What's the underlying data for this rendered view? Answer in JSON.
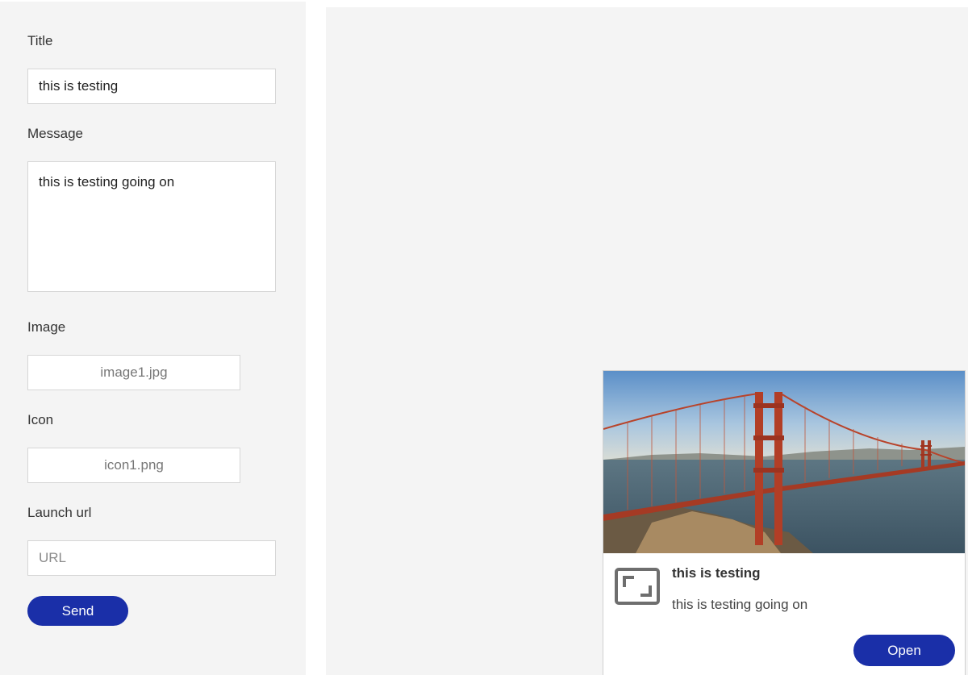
{
  "form": {
    "title_label": "Title",
    "title_value": "this is testing",
    "message_label": "Message",
    "message_value": "this is testing going on",
    "image_label": "Image",
    "image_file": "image1.jpg",
    "icon_label": "Icon",
    "icon_file": "icon1.png",
    "launch_url_label": "Launch url",
    "launch_url_placeholder": "URL",
    "send_label": "Send"
  },
  "preview": {
    "image_alt": "golden-gate-bridge-photo",
    "icon": "expand-frame-icon",
    "title": "this is testing",
    "message": "this is testing going on",
    "open_label": "Open"
  },
  "colors": {
    "accent": "#1a2fa8",
    "panel_bg": "#f4f4f4",
    "field_border": "#d6d6d6"
  }
}
